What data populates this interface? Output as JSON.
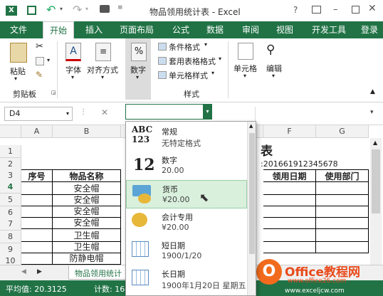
{
  "window": {
    "title": "物品领用统计表 - Excel",
    "help": "?"
  },
  "tabs": [
    "文件",
    "开始",
    "插入",
    "页面布局",
    "公式",
    "数据",
    "审阅",
    "视图",
    "开发工具",
    "登录"
  ],
  "ribbon": {
    "paste": "粘贴",
    "clipboard": "剪贴板",
    "font": "字体",
    "align": "对齐方式",
    "number": "数字",
    "cond": "条件格式",
    "tablefmt": "套用表格格式",
    "cellstyle": "单元格样式",
    "styles": "样式",
    "cells": "单元格",
    "edit": "编辑"
  },
  "formula": {
    "namebox": "D4",
    "cancel": "✕"
  },
  "columns": [
    "A",
    "B",
    "F",
    "G"
  ],
  "rows": [
    "1",
    "2",
    "3",
    "4",
    "5",
    "6",
    "7",
    "8",
    "9",
    "10"
  ],
  "sheet": {
    "title_fragment": "表",
    "order_no": ":201661912345678",
    "h_seq": "序号",
    "h_name": "物品名称",
    "h_date": "领用日期",
    "h_dept": "使用部门",
    "items": [
      "安全帽",
      "安全帽",
      "安全帽",
      "安全帽",
      "卫生帽",
      "卫生帽",
      "防静电帽"
    ]
  },
  "sheettab": "物品领用统计",
  "statusbar": {
    "avg": "平均值: 20.3125",
    "count": "计数: 16"
  },
  "dropdown": [
    {
      "title": "常规",
      "sub": "无特定格式",
      "icon": "ABC123"
    },
    {
      "title": "数字",
      "sub": "20.00",
      "icon": "12"
    },
    {
      "title": "货币",
      "sub": "¥20.00",
      "icon": "currency"
    },
    {
      "title": "会计专用",
      "sub": "¥20.00",
      "icon": "accounting"
    },
    {
      "title": "短日期",
      "sub": "1900/1/20",
      "icon": "calendar"
    },
    {
      "title": "长日期",
      "sub": "1900年1月20日 星期五",
      "icon": "calendar"
    }
  ],
  "watermark": {
    "brand": "Office教程网",
    "url": "www.office26.com",
    "url2": "www.exceljcw.com"
  }
}
